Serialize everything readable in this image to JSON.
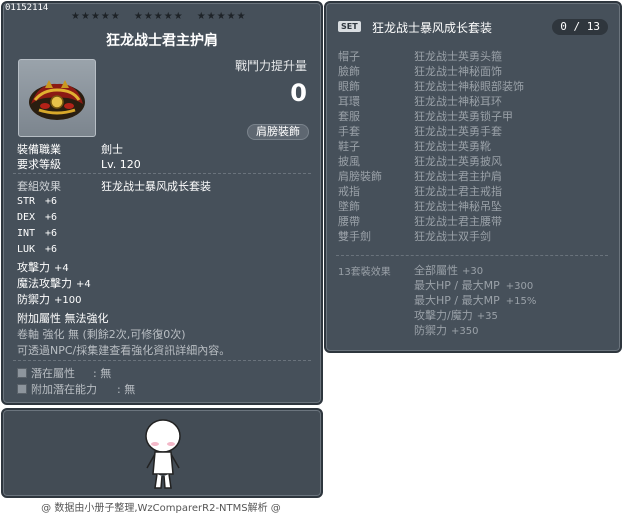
{
  "item": {
    "id": "01152114",
    "name": "狂龙战士君主护肩",
    "power_label": "戰鬥力提升量",
    "power_value": "0",
    "slot_badge": "肩膀裝飾",
    "requirements": [
      {
        "label": "裝備職業",
        "value": "劍士"
      },
      {
        "label": "要求等級",
        "value": "Lv. 120"
      }
    ],
    "set_effect_label": "套組效果",
    "set_effect_value": "狂龙战士暴风成长套装",
    "stats": [
      {
        "label": "STR",
        "value": "+6"
      },
      {
        "label": "DEX",
        "value": "+6"
      },
      {
        "label": "INT",
        "value": "+6"
      },
      {
        "label": "LUK",
        "value": "+6"
      }
    ],
    "stats_cjk": [
      {
        "label": "攻擊力",
        "value": "+4"
      },
      {
        "label": "魔法攻擊力",
        "value": "+4"
      },
      {
        "label": "防禦力",
        "value": "+100"
      }
    ],
    "extra_attr": "附加屬性  無法強化",
    "scroll_info": "卷軸 強化 無 (剩餘2次,可修復0次)",
    "upgrade_hint": "可透過NPC/採集建查看強化資訊詳細內容。",
    "potential": {
      "label": "潛在屬性",
      "sep": ":",
      "value": "無"
    },
    "add_potential": {
      "label": "附加潛在能力",
      "sep": ":",
      "value": "無"
    }
  },
  "set": {
    "badge": "SET",
    "title": "狂龙战士暴风成长套装",
    "count": "0 / 13",
    "items": [
      {
        "slot": "帽子",
        "name": "狂龙战士英勇头箍"
      },
      {
        "slot": "臉飾",
        "name": "狂龙战士神秘面饰"
      },
      {
        "slot": "眼飾",
        "name": "狂龙战士神秘眼部装饰"
      },
      {
        "slot": "耳環",
        "name": "狂龙战士神秘耳环"
      },
      {
        "slot": "套服",
        "name": "狂龙战士英勇锁子甲"
      },
      {
        "slot": "手套",
        "name": "狂龙战士英勇手套"
      },
      {
        "slot": "鞋子",
        "name": "狂龙战士英勇靴"
      },
      {
        "slot": "披風",
        "name": "狂龙战士英勇披风"
      },
      {
        "slot": "肩膀裝飾",
        "name": "狂龙战士君主护肩"
      },
      {
        "slot": "戒指",
        "name": "狂龙战士君主戒指"
      },
      {
        "slot": "墜飾",
        "name": "狂龙战士神秘吊坠"
      },
      {
        "slot": "腰帶",
        "name": "狂龙战士君主腰带"
      },
      {
        "slot": "雙手劍",
        "name": "狂龙战士双手剑"
      }
    ],
    "bonus_head": "13套裝效果",
    "bonuses": [
      {
        "label": "全部屬性",
        "value": "+30"
      },
      {
        "label": "最大HP / 最大MP",
        "value": "+300"
      },
      {
        "label": "最大HP / 最大MP",
        "value": "+15%"
      },
      {
        "label": "攻擊力/魔力",
        "value": "+35"
      },
      {
        "label": "防禦力",
        "value": "+350"
      }
    ]
  },
  "footer": {
    "credit": "@ 数据由小册子整理,WzComparerR2-NTMS解析 @"
  }
}
